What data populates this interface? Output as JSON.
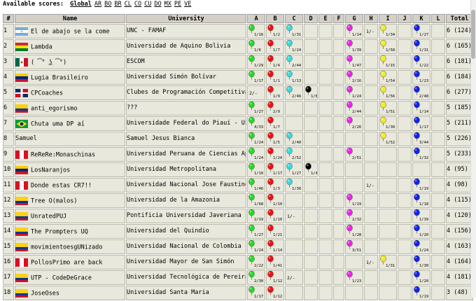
{
  "topbar": {
    "label": "Available scores:",
    "links": [
      "Global",
      "AR",
      "BO",
      "BR",
      "CL",
      "CO",
      "CU",
      "DO",
      "MX",
      "PE",
      "VE"
    ]
  },
  "table": {
    "headers": [
      "#",
      "Name",
      "University",
      "A",
      "B",
      "C",
      "D",
      "E",
      "F",
      "G",
      "H",
      "I",
      "J",
      "K",
      "L",
      "Total"
    ],
    "problems": [
      "A",
      "B",
      "C",
      "D",
      "E",
      "F",
      "G",
      "H",
      "I",
      "J",
      "K",
      "L"
    ],
    "problem_colors": {
      "A": "#22dd22",
      "B": "#ee1111",
      "C": "#33dddd",
      "D": "#000000",
      "G": "#ee22ee",
      "I": "#eeee22",
      "K": "#1122ee"
    },
    "rows": [
      {
        "rank": "1",
        "flag": "AR",
        "name": "El de abajo se la come",
        "university": "UNC - FAMAF",
        "total": "6 (124)",
        "cells": {
          "A": {
            "b": 1,
            "t": "1/16"
          },
          "B": {
            "b": 1,
            "t": "1/2"
          },
          "C": {
            "b": 1,
            "t": "1/31"
          },
          "G": {
            "b": 1,
            "t": "1/14"
          },
          "H": {
            "b": 0,
            "t": "1/-"
          },
          "I": {
            "b": 1,
            "t": "1/34"
          },
          "K": {
            "b": 1,
            "t": "1/27"
          }
        }
      },
      {
        "rank": "2",
        "flag": "BO",
        "name": "Lambda",
        "university": "Universidad de Aquino Bolivia",
        "total": "6 (165)",
        "cells": {
          "A": {
            "b": 1,
            "t": "1/6"
          },
          "B": {
            "b": 1,
            "t": "1/7"
          },
          "C": {
            "b": 1,
            "t": "1/24"
          },
          "G": {
            "b": 1,
            "t": "1/39"
          },
          "I": {
            "b": 1,
            "t": "1/58"
          },
          "K": {
            "b": 1,
            "t": "1/31"
          }
        }
      },
      {
        "rank": "3",
        "flag": "MX",
        "name": "( ͡° ͜ʖ ͡°)",
        "university": "ESCOM",
        "total": "6 (181)",
        "cells": {
          "A": {
            "b": 1,
            "t": "1/29"
          },
          "B": {
            "b": 1,
            "t": "1/4"
          },
          "C": {
            "b": 1,
            "t": "2/44"
          },
          "G": {
            "b": 1,
            "t": "1/47"
          },
          "I": {
            "b": 1,
            "t": "1/15"
          },
          "K": {
            "b": 1,
            "t": "1/22"
          }
        }
      },
      {
        "rank": "4",
        "flag": "VE",
        "name": "Lugia Brasileiro",
        "university": "Universidad Simón Bolívar",
        "total": "6 (184)",
        "cells": {
          "A": {
            "b": 1,
            "t": "1/17"
          },
          "B": {
            "b": 1,
            "t": "1/1"
          },
          "C": {
            "b": 1,
            "t": "1/13"
          },
          "G": {
            "b": 1,
            "t": "2/16"
          },
          "I": {
            "b": 1,
            "t": "1/54"
          },
          "K": {
            "b": 1,
            "t": "1/23"
          }
        }
      },
      {
        "rank": "5",
        "flag": "DO",
        "name": "CPCoaches",
        "university": "Clubes de Programación Competitiva",
        "total": "6 (277)",
        "cells": {
          "A": {
            "b": 0,
            "t": "2/-"
          },
          "B": {
            "b": 1,
            "t": "1/9"
          },
          "C": {
            "b": 1,
            "t": "2/46"
          },
          "D": {
            "b": 1,
            "t": "1/89"
          },
          "G": {
            "b": 1,
            "t": "1/24"
          },
          "I": {
            "b": 1,
            "t": "1/56"
          },
          "K": {
            "b": 1,
            "t": "2/48"
          }
        }
      },
      {
        "rank": "6",
        "flag": "CO",
        "name": "anti_egorismo",
        "university": "???",
        "total": "5 (185)",
        "cells": {
          "A": {
            "b": 1,
            "t": "1/27"
          },
          "B": {
            "b": 1,
            "t": "2/9"
          },
          "G": {
            "b": 1,
            "t": "2/44"
          },
          "I": {
            "b": 1,
            "t": "1/51"
          },
          "K": {
            "b": 1,
            "t": "1/14"
          }
        }
      },
      {
        "rank": "7",
        "flag": "BR",
        "name": "Chuta uma DP aí",
        "university": "Universidade Federal do Piauí - UFPI",
        "total": "5 (211)",
        "cells": {
          "A": {
            "b": 1,
            "t": "4/33"
          },
          "B": {
            "b": 1,
            "t": "1/7"
          },
          "G": {
            "b": 1,
            "t": "2/26"
          },
          "I": {
            "b": 1,
            "t": "1/30"
          },
          "K": {
            "b": 1,
            "t": "1/17"
          }
        }
      },
      {
        "rank": "8",
        "flag": "",
        "name": "Samuel",
        "university": "Samuel Jesus Bianca",
        "total": "5 (226)",
        "cells": {
          "A": {
            "b": 1,
            "t": "1/24"
          },
          "B": {
            "b": 1,
            "t": "1/5"
          },
          "C": {
            "b": 1,
            "t": "2/40"
          },
          "I": {
            "b": 1,
            "t": "1/52"
          },
          "K": {
            "b": 1,
            "t": "3/44"
          }
        }
      },
      {
        "rank": "9",
        "flag": "PE",
        "name": "ReReRe:Monaschinas",
        "university": "Universidad Peruana de Ciencias Aplicadas",
        "total": "5 (233)",
        "cells": {
          "A": {
            "b": 1,
            "t": "1/24"
          },
          "B": {
            "b": 1,
            "t": "1/24"
          },
          "C": {
            "b": 1,
            "t": "2/52"
          },
          "G": {
            "b": 1,
            "t": "2/51"
          },
          "K": {
            "b": 1,
            "t": "1/32"
          }
        }
      },
      {
        "rank": "10",
        "flag": "VE",
        "name": "LosNaranjos",
        "university": "Universidad Metropolitana",
        "total": "4 (95)",
        "cells": {
          "A": {
            "b": 1,
            "t": "1/10"
          },
          "B": {
            "b": 1,
            "t": "1/17"
          },
          "C": {
            "b": 1,
            "t": "1/27"
          },
          "D": {
            "b": 1,
            "t": "1/41"
          }
        }
      },
      {
        "rank": "11",
        "flag": "PE",
        "name": "Donde estas CR7!!",
        "university": "Universidad Nacional Jose Faustino Sanchez Carrion",
        "total": "4 (98)",
        "cells": {
          "A": {
            "b": 1,
            "t": "1/46"
          },
          "B": {
            "b": 1,
            "t": "1/3"
          },
          "C": {
            "b": 1,
            "t": "1/30"
          },
          "H": {
            "b": 0,
            "t": "1/-"
          },
          "K": {
            "b": 1,
            "t": "1/19"
          }
        }
      },
      {
        "rank": "12",
        "flag": "CO",
        "name": "Tree O(malos)",
        "university": "Universidad de la Amazonia",
        "total": "4 (115)",
        "cells": {
          "A": {
            "b": 1,
            "t": "1/68"
          },
          "B": {
            "b": 1,
            "t": "1/10"
          },
          "G": {
            "b": 1,
            "t": "1/19"
          },
          "K": {
            "b": 1,
            "t": "1/18"
          }
        }
      },
      {
        "rank": "13",
        "flag": "CO",
        "name": "UnratedPUJ",
        "university": "Pontificia Universidad Javeriana",
        "total": "4 (120)",
        "cells": {
          "A": {
            "b": 1,
            "t": "2/19"
          },
          "B": {
            "b": 1,
            "t": "1/10"
          },
          "C": {
            "b": 0,
            "t": "1/-"
          },
          "G": {
            "b": 1,
            "t": "2/32"
          },
          "K": {
            "b": 1,
            "t": "1/39"
          }
        }
      },
      {
        "rank": "14",
        "flag": "CO",
        "name": "The Prompters UQ",
        "university": "Universidad del Quindio",
        "total": "4 (156)",
        "cells": {
          "A": {
            "b": 1,
            "t": "1/27"
          },
          "B": {
            "b": 1,
            "t": "1/21"
          },
          "G": {
            "b": 1,
            "t": "1/28"
          },
          "K": {
            "b": 1,
            "t": "1/20"
          }
        }
      },
      {
        "rank": "15",
        "flag": "CO",
        "name": "movimientoesgUNizado",
        "university": "Universidad Nacional de Colombia",
        "total": "4 (163)",
        "cells": {
          "A": {
            "b": 1,
            "t": "1/24"
          },
          "B": {
            "b": 1,
            "t": "1/14"
          },
          "G": {
            "b": 1,
            "t": "3/51"
          },
          "K": {
            "b": 1,
            "t": "1/24"
          }
        }
      },
      {
        "rank": "16",
        "flag": "PE",
        "name": "PollosPrimo are back",
        "university": "Universidad Mayor de San Simón",
        "total": "4 (164)",
        "cells": {
          "A": {
            "b": 1,
            "t": "2/22"
          },
          "B": {
            "b": 1,
            "t": "1/41"
          },
          "H": {
            "b": 0,
            "t": "1/-"
          },
          "I": {
            "b": 1,
            "t": "1/31"
          },
          "K": {
            "b": 1,
            "t": "1/30"
          }
        }
      },
      {
        "rank": "17",
        "flag": "CO",
        "name": "UTP - CodeDeGrace",
        "university": "Universidad Tecnológica de Pereira",
        "total": "4 (181)",
        "cells": {
          "A": {
            "b": 1,
            "t": "2/30"
          },
          "B": {
            "b": 1,
            "t": "1/12"
          },
          "C": {
            "b": 0,
            "t": "2/-"
          },
          "G": {
            "b": 1,
            "t": "1/23"
          },
          "K": {
            "b": 1,
            "t": "1/20"
          }
        }
      },
      {
        "rank": "18",
        "flag": "CO",
        "name": "JoseOses",
        "university": "Universidad Santa Maria",
        "total": "3 (48)",
        "cells": {
          "A": {
            "b": 1,
            "t": "1/17"
          },
          "B": {
            "b": 1,
            "t": "1/12"
          },
          "K": {
            "b": 1,
            "t": "1/19"
          }
        }
      }
    ]
  }
}
